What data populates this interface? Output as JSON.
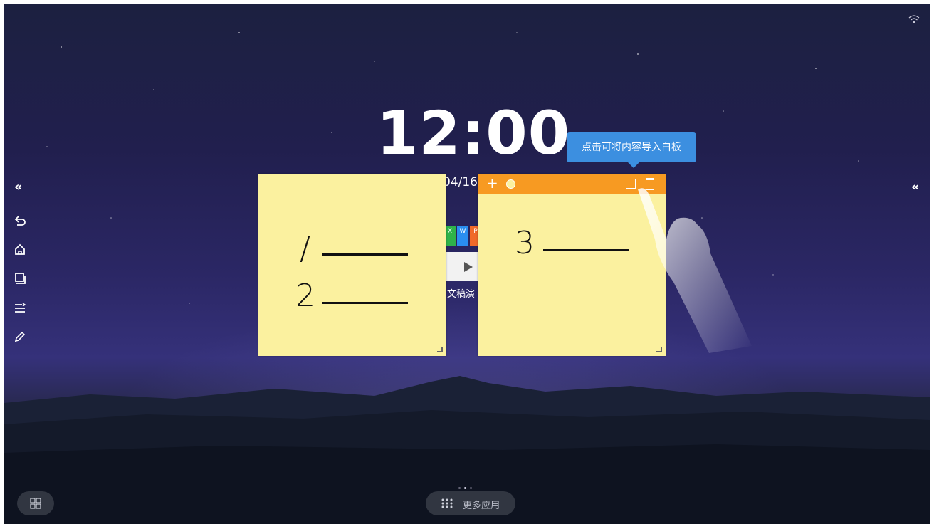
{
  "clock": {
    "time": "12:00",
    "date_fragment": "04/16"
  },
  "tooltip": {
    "text": "点击可将内容导入白板"
  },
  "app_tile": {
    "icons": [
      "X",
      "W",
      "P"
    ],
    "label": "文稿演"
  },
  "notes": [
    {
      "id": "note-1",
      "lines": [
        "/",
        "2"
      ]
    },
    {
      "id": "note-2",
      "lines": [
        "3"
      ],
      "toolbar": {
        "add_icon": "+"
      }
    }
  ],
  "bottom_bar": {
    "more_apps_label": "更多应用"
  },
  "sidebar": {
    "collapse_glyph": "«"
  },
  "colors": {
    "note_yellow": "#fbf19f",
    "toolbar_orange": "#f79a22",
    "tooltip_blue": "#3c8fe0"
  },
  "icons": [
    "wifi-icon",
    "undo-icon",
    "home-icon",
    "window-icon",
    "menu-icon",
    "pen-icon",
    "grid-icon",
    "apps-icon"
  ]
}
